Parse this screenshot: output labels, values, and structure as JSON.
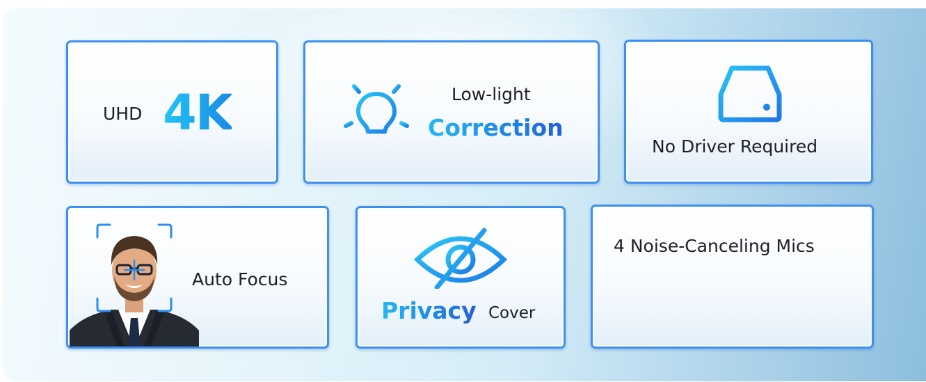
{
  "features": [
    {
      "id": "uhd",
      "label": "UHD",
      "accent": "4K"
    },
    {
      "id": "low-light",
      "line1": "Low-light",
      "accent": "Correction",
      "icon": "lightbulb-icon"
    },
    {
      "id": "no-driver",
      "label": "No Driver Required",
      "icon": "hard-drive-icon"
    },
    {
      "id": "auto-focus",
      "label": "Auto Focus",
      "icon": "face-focus-portrait"
    },
    {
      "id": "privacy",
      "accent": "Privacy",
      "label": "Cover",
      "icon": "eye-slash-icon"
    },
    {
      "id": "mics",
      "label": "4 Noise-Canceling Mics",
      "icon": "sound-wave-icon"
    }
  ],
  "colors": {
    "card_border": "#3d8ff0",
    "accent_start": "#27b7f2",
    "accent_end": "#2560d8",
    "text": "#1e1e24"
  }
}
